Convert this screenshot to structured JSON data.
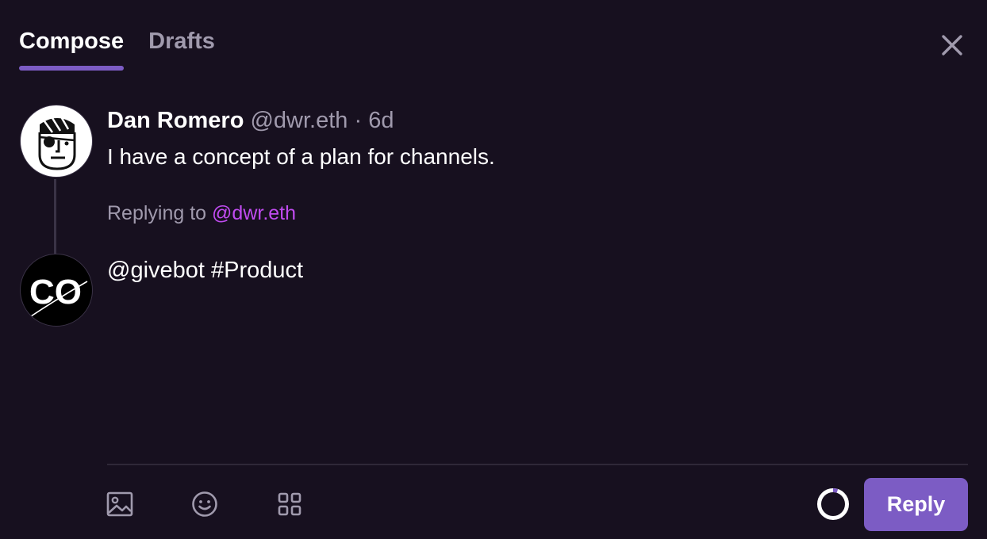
{
  "tabs": [
    {
      "label": "Compose",
      "active": true
    },
    {
      "label": "Drafts",
      "active": false
    }
  ],
  "parent_cast": {
    "author_name": "Dan Romero",
    "author_handle": "@dwr.eth",
    "age": "· 6d",
    "text": "I have a concept of a plan for channels."
  },
  "replying": {
    "prefix": "Replying to ",
    "mention": "@dwr.eth"
  },
  "composer": {
    "text": "@givebot #Product",
    "avatar_letters": "CO"
  },
  "toolbar": {
    "icons": [
      "image-icon",
      "emoji-icon",
      "grid-icon"
    ],
    "reply_label": "Reply",
    "char_progress": 0.05
  },
  "colors": {
    "background": "#17101f",
    "accent": "#7c5cc4",
    "mention": "#c04bf0",
    "muted": "#a09aad"
  }
}
